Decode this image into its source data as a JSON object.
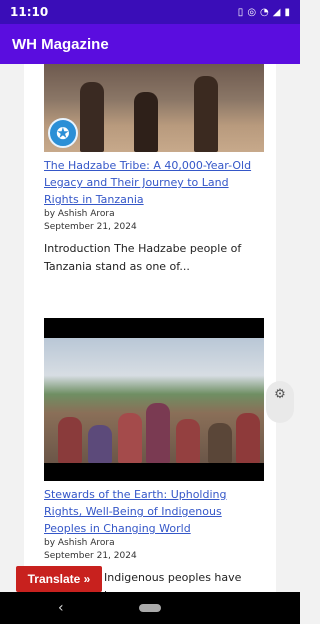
{
  "status": {
    "time": "11:10"
  },
  "app": {
    "title": "WH Magazine"
  },
  "articles": [
    {
      "title": "The Hadzabe Tribe: A 40,000-Year-Old Legacy and Their Journey to Land Rights in Tanzania",
      "author": "by Ashish Arora",
      "date": "September 21, 2024",
      "excerpt": "Introduction The Hadzabe people of Tanzania stand as one of..."
    },
    {
      "title": "Stewards of the Earth: Upholding Rights, Well-Being of Indigenous Peoples in Changing World",
      "author": "by Ashish Arora",
      "date": "September 21, 2024",
      "excerpt": "Indigenous peoples have long"
    }
  ],
  "translate": {
    "label": "Translate »"
  },
  "icons": {
    "settings": "gear-icon",
    "un_logo": "un-emblem-icon",
    "back": "back-icon",
    "home": "home-pill-icon"
  }
}
